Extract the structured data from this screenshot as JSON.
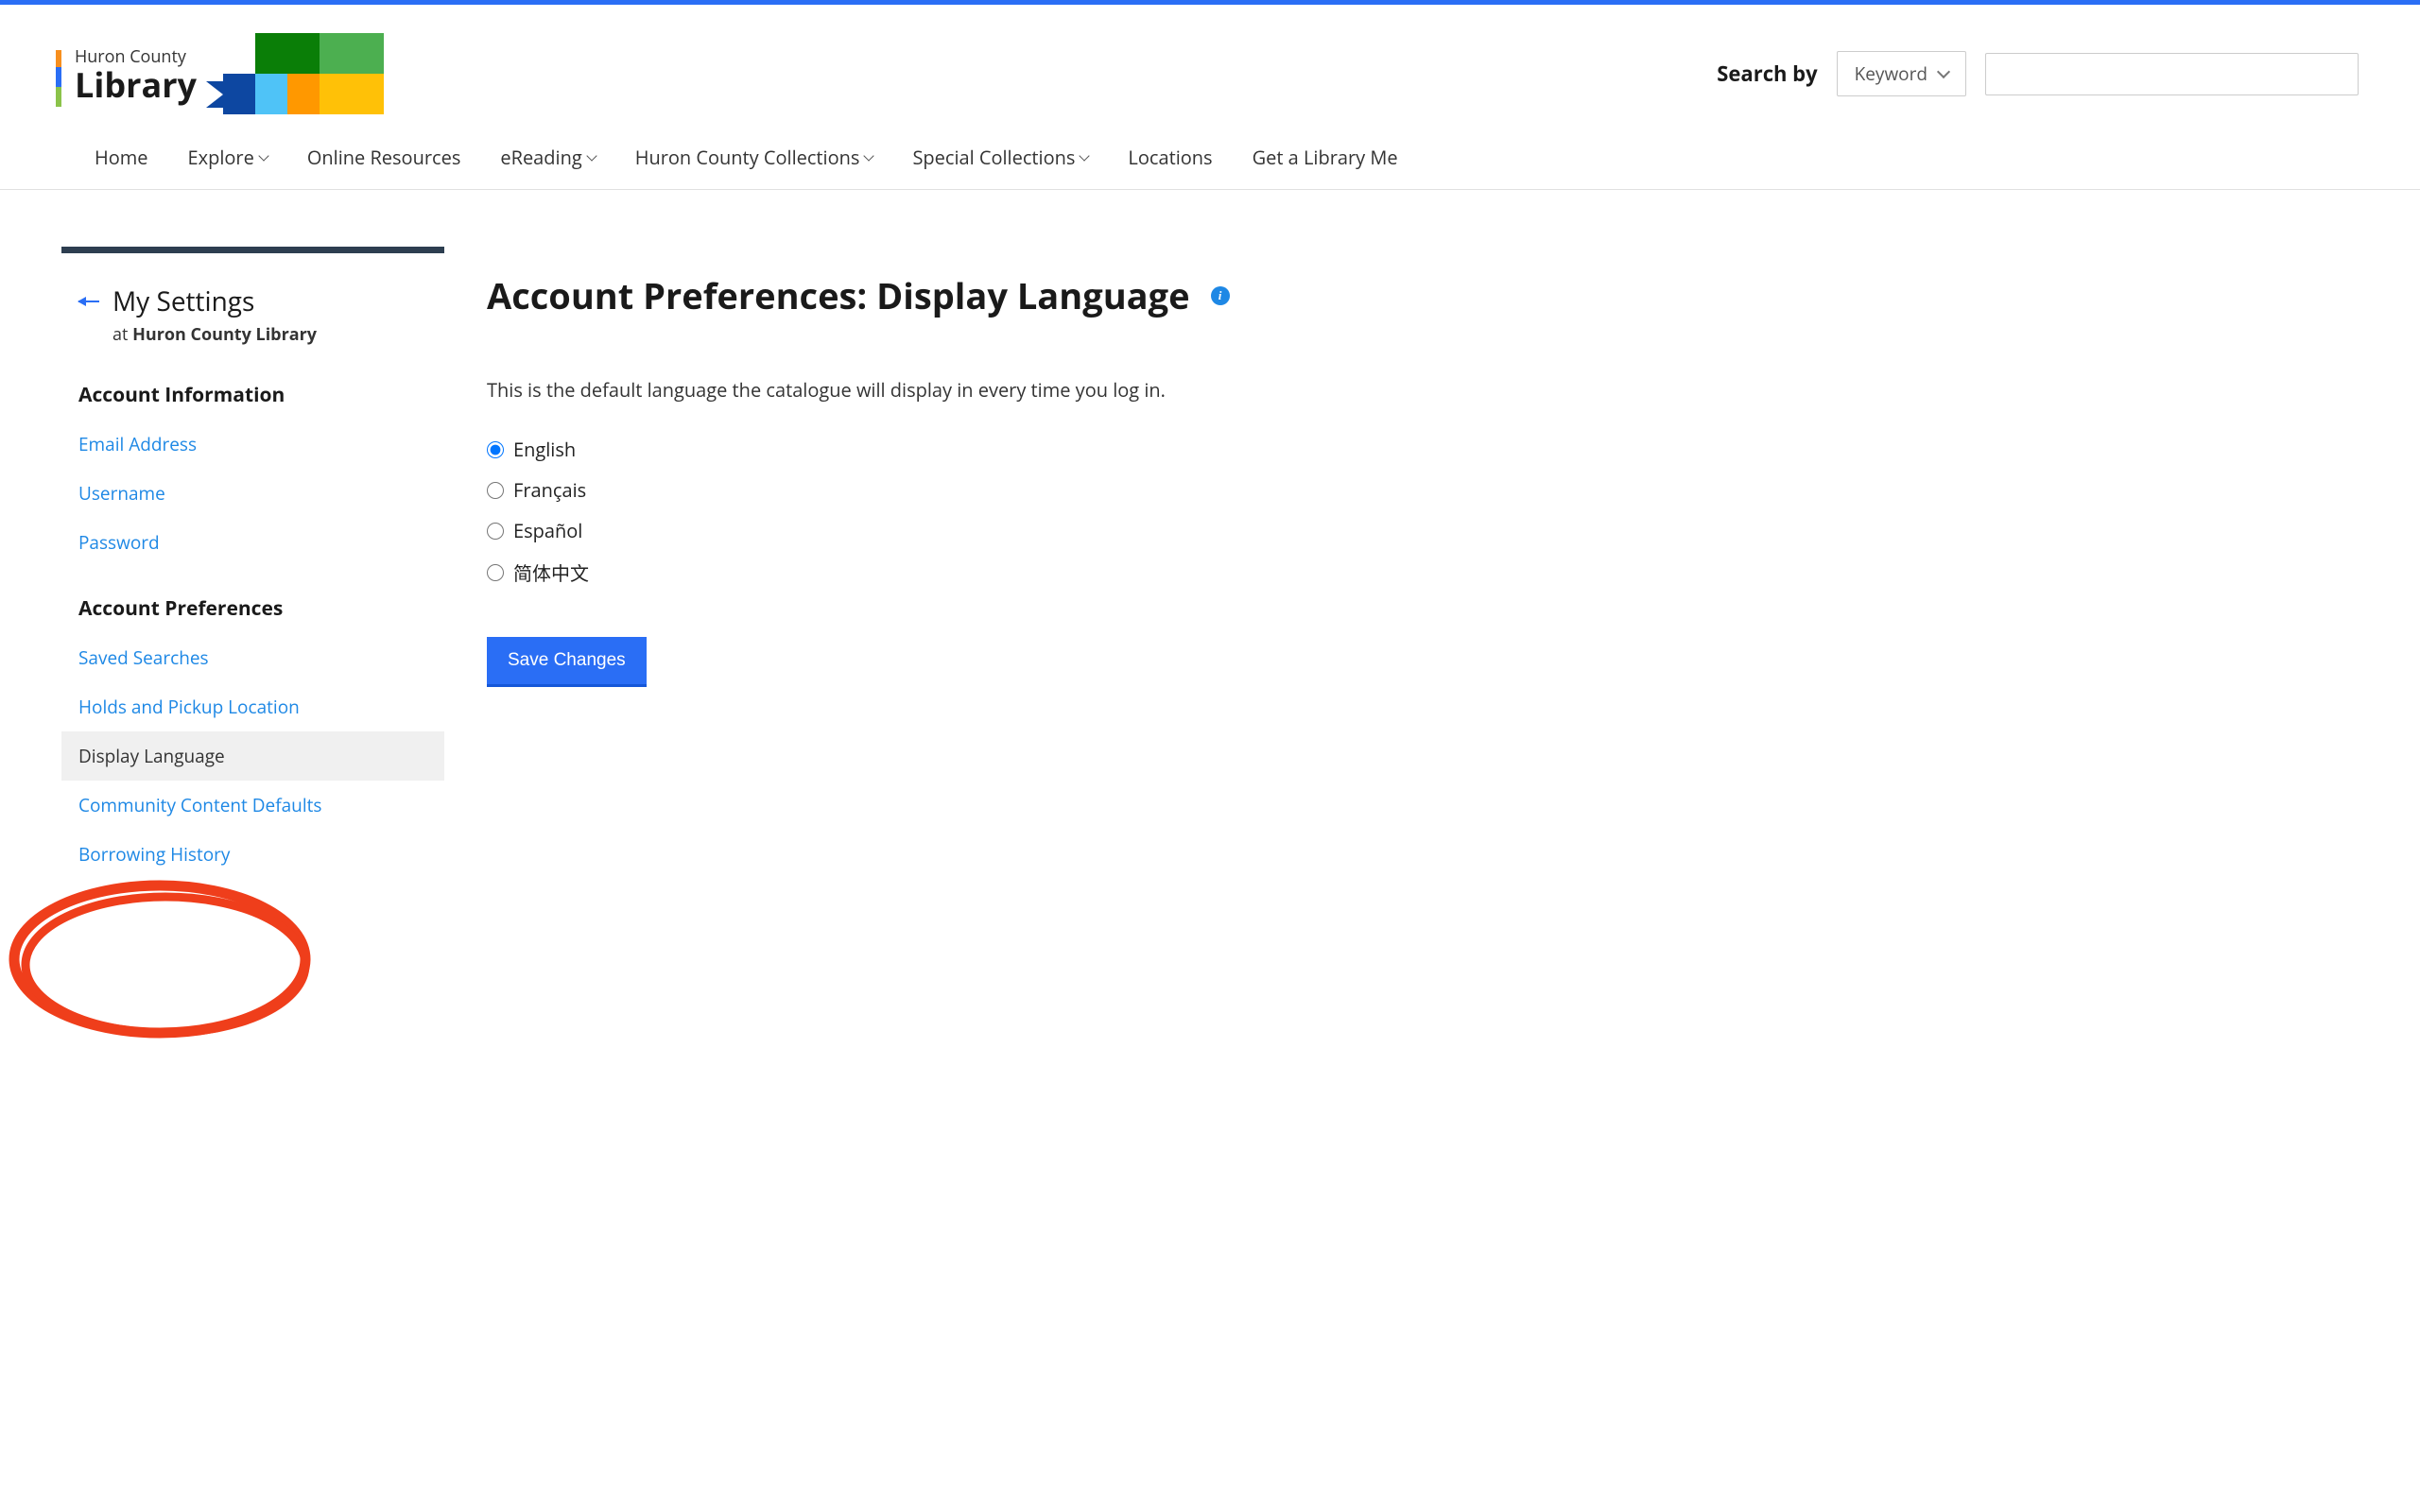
{
  "logo": {
    "line1": "Huron County",
    "line2": "Library"
  },
  "search": {
    "label": "Search by",
    "dropdown_selected": "Keyword",
    "input_value": ""
  },
  "nav": {
    "items": [
      {
        "label": "Home",
        "dropdown": false
      },
      {
        "label": "Explore",
        "dropdown": true
      },
      {
        "label": "Online Resources",
        "dropdown": false
      },
      {
        "label": "eReading",
        "dropdown": true
      },
      {
        "label": "Huron County Collections",
        "dropdown": true
      },
      {
        "label": "Special Collections",
        "dropdown": true
      },
      {
        "label": "Locations",
        "dropdown": false
      },
      {
        "label": "Get a Library Me",
        "dropdown": false
      }
    ]
  },
  "sidebar": {
    "back_label": "My Settings",
    "subtext_prefix": "at ",
    "subtext_library": "Huron County Library",
    "sections": [
      {
        "title": "Account Information",
        "links": [
          {
            "label": "Email Address",
            "active": false
          },
          {
            "label": "Username",
            "active": false
          },
          {
            "label": "Password",
            "active": false
          }
        ]
      },
      {
        "title": "Account Preferences",
        "links": [
          {
            "label": "Saved Searches",
            "active": false
          },
          {
            "label": "Holds and Pickup Location",
            "active": false
          },
          {
            "label": "Display Language",
            "active": true
          },
          {
            "label": "Community Content Defaults",
            "active": false
          },
          {
            "label": "Borrowing History",
            "active": false
          }
        ]
      }
    ]
  },
  "main": {
    "title": "Account Preferences: Display Language",
    "description": "This is the default language the catalogue will display in every time you log in.",
    "languages": [
      {
        "label": "English",
        "checked": true
      },
      {
        "label": "Français",
        "checked": false
      },
      {
        "label": "Español",
        "checked": false
      },
      {
        "label": "简体中文",
        "checked": false
      }
    ],
    "save_label": "Save Changes"
  }
}
